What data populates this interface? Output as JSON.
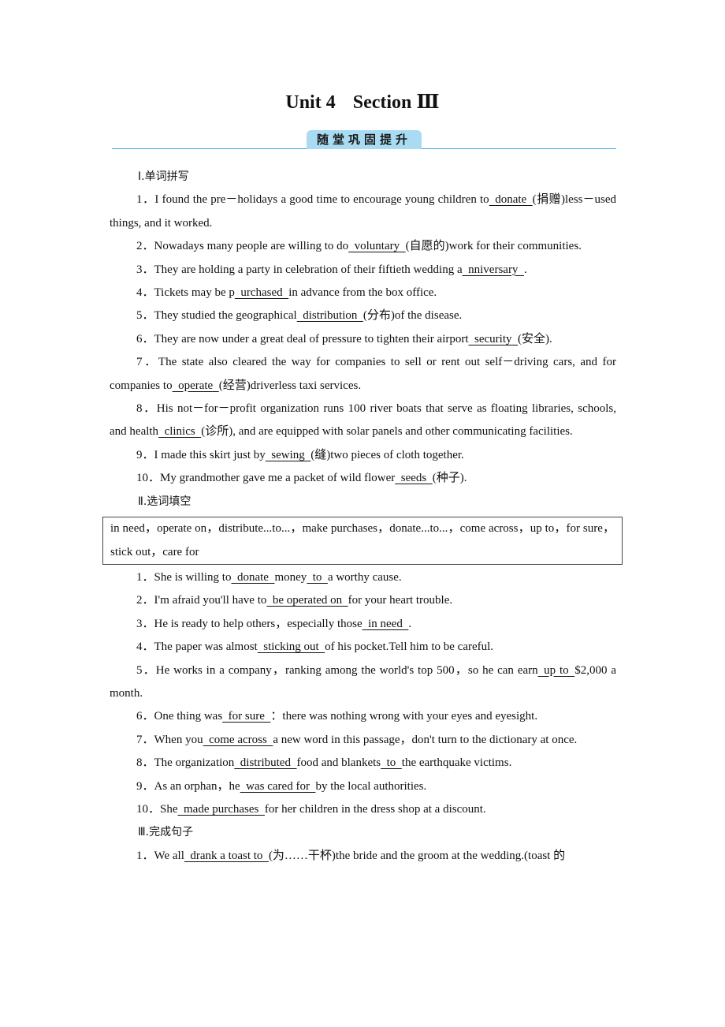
{
  "header": {
    "unit": "Unit 4",
    "section": "Section Ⅲ",
    "banner": "随堂巩固提升",
    "accent_color": "#3fb2e6",
    "banner_color": "#a9dcf3"
  },
  "part1": {
    "heading": "Ⅰ.单词拼写",
    "items": [
      {
        "num": "1．",
        "pre": "I found the pre－holidays a good time to encourage young children to",
        "ans": "donate",
        "post": "(捐赠)less－used things, and it worked."
      },
      {
        "num": "2．",
        "pre": "Nowadays many people are willing to do",
        "ans": "voluntary",
        "post": "(自愿的)work for their communities."
      },
      {
        "num": "3．",
        "pre": "They are holding a party in celebration of their fiftieth wedding a",
        "ans": "nniversary",
        "post": "."
      },
      {
        "num": "4．",
        "pre": "Tickets may be p",
        "ans": "urchased",
        "post": "in advance from the box office."
      },
      {
        "num": "5．",
        "pre": "They studied the geographical",
        "ans": "distribution",
        "post": "(分布)of the disease."
      },
      {
        "num": "6．",
        "pre": "They are now under a great deal of pressure to tighten their airport",
        "ans": "security",
        "post": "(安全)."
      },
      {
        "num": "7．",
        "pre": "The state also cleared the way for companies to sell or rent out self－driving cars, and for companies to",
        "ans": "operate",
        "post": "(经营)driverless taxi services."
      },
      {
        "num": "8．",
        "pre": "His not－for－profit organization runs 100 river boats that serve as floating libraries, schools, and health",
        "ans": "clinics",
        "post": "(诊所), and are equipped with solar panels and other communicating facilities."
      },
      {
        "num": "9．",
        "pre": "I made this skirt just by",
        "ans": "sewing",
        "post": "(缝)two pieces of cloth together."
      },
      {
        "num": "10．",
        "pre": "My grandmother gave me a packet of wild flower",
        "ans": "seeds",
        "post": "(种子)."
      }
    ]
  },
  "part2": {
    "heading": "Ⅱ.选词填空",
    "word_box": "in need，operate on，distribute...to...，make purchases，donate...to...，come across，up to，for sure，stick out，care for",
    "items": [
      {
        "num": "1．",
        "t1": "She is willing to",
        "a1": "donate",
        "t2": "money",
        "a2": "to",
        "t3": "a worthy cause."
      },
      {
        "num": "2．",
        "t1": "I'm afraid you'll have to",
        "a1": "be operated on",
        "t2": "for your heart trouble."
      },
      {
        "num": "3．",
        "t1": "He is ready to help others，especially those",
        "a1": "in need",
        "t2": "."
      },
      {
        "num": "4．",
        "t1": "The paper was almost",
        "a1": "sticking out",
        "t2": "of his pocket.Tell him to be careful."
      },
      {
        "num": "5．",
        "t1": "He works in a company，ranking among the world's top 500，so he can earn",
        "a1": "up to",
        "t2": "$2,000 a month."
      },
      {
        "num": "6．",
        "t1": "One thing was",
        "a1": "for sure",
        "t2": "：there was nothing wrong with your eyes and eyesight."
      },
      {
        "num": "7．",
        "t1": "When you",
        "a1": "come across",
        "t2": "a new word in this passage，don't turn to the dictionary at once."
      },
      {
        "num": "8．",
        "t1": "The organization",
        "a1": "distributed",
        "t2": "food and blankets",
        "a2": "to",
        "t3": "the earthquake victims."
      },
      {
        "num": "9．",
        "t1": "As an orphan，he",
        "a1": "was cared for",
        "t2": "by the local authorities."
      },
      {
        "num": "10．",
        "t1": "She",
        "a1": "made purchases",
        "t2": "for her children in the dress shop at a discount."
      }
    ]
  },
  "part3": {
    "heading": "Ⅲ.完成句子",
    "items": [
      {
        "num": "1．",
        "pre": "We all",
        "ans": "drank a toast to",
        "post": "(为……干杯)the bride and the groom at the wedding.(toast 的"
      }
    ]
  }
}
